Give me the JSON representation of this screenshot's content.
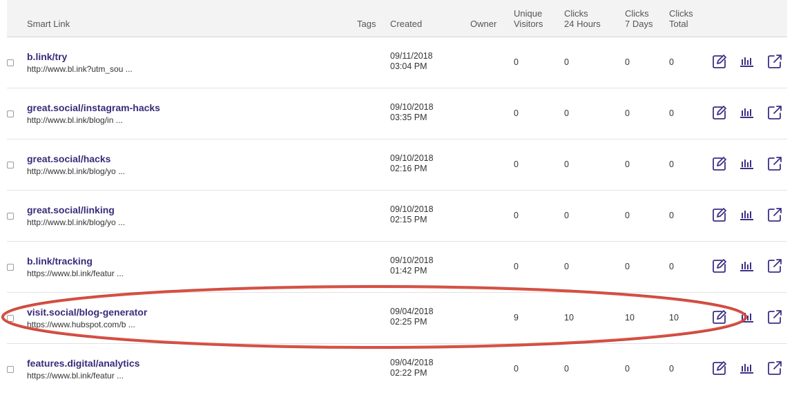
{
  "columns": {
    "smart_link": "Smart Link",
    "tags": "Tags",
    "created": "Created",
    "owner": "Owner",
    "unique_visitors": [
      "Unique",
      "Visitors"
    ],
    "clicks_24h": [
      "Clicks",
      "24 Hours"
    ],
    "clicks_7d": [
      "Clicks",
      "7 Days"
    ],
    "clicks_total": [
      "Clicks",
      "Total"
    ]
  },
  "rows": [
    {
      "title": "b.link/try",
      "url": "http://www.bl.ink?utm_sou ...",
      "date": "09/11/2018",
      "time": "03:04 PM",
      "unique": "0",
      "c24": "0",
      "c7": "0",
      "total": "0"
    },
    {
      "title": "great.social/instagram-hacks",
      "url": "http://www.bl.ink/blog/in ...",
      "date": "09/10/2018",
      "time": "03:35 PM",
      "unique": "0",
      "c24": "0",
      "c7": "0",
      "total": "0"
    },
    {
      "title": "great.social/hacks",
      "url": "http://www.bl.ink/blog/yo ...",
      "date": "09/10/2018",
      "time": "02:16 PM",
      "unique": "0",
      "c24": "0",
      "c7": "0",
      "total": "0"
    },
    {
      "title": "great.social/linking",
      "url": "http://www.bl.ink/blog/yo ...",
      "date": "09/10/2018",
      "time": "02:15 PM",
      "unique": "0",
      "c24": "0",
      "c7": "0",
      "total": "0"
    },
    {
      "title": "b.link/tracking",
      "url": "https://www.bl.ink/featur ...",
      "date": "09/10/2018",
      "time": "01:42 PM",
      "unique": "0",
      "c24": "0",
      "c7": "0",
      "total": "0"
    },
    {
      "title": "visit.social/blog-generator",
      "url": "https://www.hubspot.com/b ...",
      "date": "09/04/2018",
      "time": "02:25 PM",
      "unique": "9",
      "c24": "10",
      "c7": "10",
      "total": "10"
    },
    {
      "title": "features.digital/analytics",
      "url": "https://www.bl.ink/featur ...",
      "date": "09/04/2018",
      "time": "02:22 PM",
      "unique": "0",
      "c24": "0",
      "c7": "0",
      "total": "0"
    }
  ],
  "icons": {
    "edit": "edit-icon",
    "stats": "bar-chart-icon",
    "open": "external-link-icon"
  },
  "colors": {
    "accent": "#3b2b7a",
    "icon": "#3d2d85",
    "highlight": "#d9473a"
  }
}
